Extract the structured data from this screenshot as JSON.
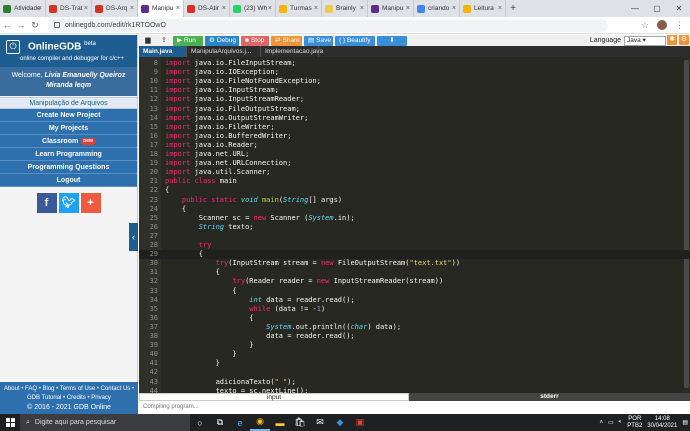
{
  "browser": {
    "tabs": [
      {
        "label": "Atividade",
        "color": "#2e7d32",
        "active": false
      },
      {
        "label": "DS-Trat",
        "color": "#d93025",
        "active": false
      },
      {
        "label": "DS-Arq",
        "color": "#d93025",
        "active": false
      },
      {
        "label": "Manipu",
        "color": "#5c2d91",
        "active": true
      },
      {
        "label": "DS-Atir",
        "color": "#d93025",
        "active": false
      },
      {
        "label": "(23) Wh",
        "color": "#25d366",
        "active": false
      },
      {
        "label": "Turmas",
        "color": "#f4b400",
        "active": false
      },
      {
        "label": "Brainly",
        "color": "#f2c94c",
        "active": false
      },
      {
        "label": "Manipu",
        "color": "#5c2d91",
        "active": false
      },
      {
        "label": "criando",
        "color": "#4285f4",
        "active": false
      },
      {
        "label": "Leitura",
        "color": "#f4b400",
        "active": false
      }
    ],
    "url": "onlinegdb.com/edit/rk1RTOOwO",
    "new_tab": "+",
    "window_controls": [
      "—",
      "▢",
      "✕"
    ]
  },
  "sidebar": {
    "logo_title": "OnlineGDB",
    "logo_sup": "beta",
    "logo_sub": "online compiler and debugger for c/c++",
    "welcome_prefix": "Welcome, ",
    "welcome_name": "Livia Emanuelly Queiroz Miranda leqm",
    "project_title": "Manipulação de Arquivos",
    "menu": [
      "Create New Project",
      "My Projects",
      "Classroom",
      "Learn Programming",
      "Programming Questions",
      "Logout"
    ],
    "classroom_badge": "new",
    "footer_line1": "About • FAQ • Blog • Terms of Use • Contact Us •",
    "footer_line2": "GDB Tutorial • Credits • Privacy",
    "footer_copy": "© 2016 - 2021 GDB Online"
  },
  "toolbar": {
    "run": "Run",
    "debug": "Debug",
    "stop": "Stop",
    "share": "Share",
    "save": "Save",
    "beautify": "{ } Beautify",
    "language_label": "Language",
    "language_value": "Java"
  },
  "file_tabs": [
    "Main.java",
    "ManipulaArquivos.j...",
    "Implementacao.java"
  ],
  "editor": {
    "highlight_line": 29,
    "lines": [
      {
        "n": "8",
        "html": "<span class='k'>import</span> java.io.FileInputStream;"
      },
      {
        "n": "9",
        "html": "<span class='k'>import</span> java.io.IOException;"
      },
      {
        "n": "10",
        "html": "<span class='k'>import</span> java.io.FileNotFoundException;"
      },
      {
        "n": "11",
        "html": "<span class='k'>import</span> java.io.InputStream;"
      },
      {
        "n": "12",
        "html": "<span class='k'>import</span> java.io.InputStreamReader;"
      },
      {
        "n": "13",
        "html": "<span class='k'>import</span> java.io.FileOutputStream;"
      },
      {
        "n": "14",
        "html": "<span class='k'>import</span> java.io.OutputStreamWriter;"
      },
      {
        "n": "15",
        "html": "<span class='k'>import</span> java.io.FileWriter;"
      },
      {
        "n": "16",
        "html": "<span class='k'>import</span> java.io.BufferedWriter;"
      },
      {
        "n": "17",
        "html": "<span class='k'>import</span> java.io.Reader;"
      },
      {
        "n": "18",
        "html": "<span class='k'>import</span> java.net.URL;"
      },
      {
        "n": "19",
        "html": "<span class='k'>import</span> java.net.URLConnection;"
      },
      {
        "n": "20",
        "html": "<span class='k'>import</span> java.util.Scanner;"
      },
      {
        "n": "21",
        "html": "<span class='k'>public</span> <span class='k'>class</span> main"
      },
      {
        "n": "22",
        "html": "{"
      },
      {
        "n": "23",
        "html": "    <span class='k'>public</span> <span class='k'>static</span> <span class='t'>void</span> <span class='f'>main</span>(<span class='t'>String</span>[] args)"
      },
      {
        "n": "24",
        "html": "    {"
      },
      {
        "n": "25",
        "html": "        Scanner sc = <span class='k'>new</span> Scanner (<span class='t'>System</span>.in);"
      },
      {
        "n": "26",
        "html": "        <span class='t'>String</span> texto;"
      },
      {
        "n": "27",
        "html": ""
      },
      {
        "n": "28",
        "html": "        <span class='k'>try</span>"
      },
      {
        "n": "29",
        "html": "        {"
      },
      {
        "n": "30",
        "html": "            <span class='k'>try</span>(InputStream stream = <span class='k'>new</span> FileOutputStream(<span class='s'>\"text.txt\"</span>))"
      },
      {
        "n": "31",
        "html": "            {"
      },
      {
        "n": "32",
        "html": "                <span class='k'>try</span>(Reader reader = <span class='k'>new</span> InputStreamReader(stream))"
      },
      {
        "n": "33",
        "html": "                {"
      },
      {
        "n": "34",
        "html": "                    <span class='t'>int</span> data = reader.read();"
      },
      {
        "n": "35",
        "html": "                    <span class='k'>while</span> (data != -<span class='n'>1</span>)"
      },
      {
        "n": "36",
        "html": "                    {"
      },
      {
        "n": "37",
        "html": "                        <span class='t'>System</span>.out.println((<span class='t'>char</span>) data);"
      },
      {
        "n": "38",
        "html": "                        data = reader.read();"
      },
      {
        "n": "39",
        "html": "                    }"
      },
      {
        "n": "40",
        "html": "                }"
      },
      {
        "n": "41",
        "html": "            }"
      },
      {
        "n": "42",
        "html": ""
      },
      {
        "n": "43",
        "html": "            adicionaTexto(<span class='s'>\" \"</span>);"
      },
      {
        "n": "44",
        "html": "            texto = sc.nextLine();"
      }
    ]
  },
  "io": {
    "input_label": "input",
    "stderr_label": "stderr",
    "console_text": "Compiling program..."
  },
  "taskbar": {
    "search_placeholder": "Digite aqui para pesquisar",
    "lang_line1": "POR",
    "lang_line2": "PTB2",
    "time": "14:08",
    "date": "30/04/2021"
  }
}
